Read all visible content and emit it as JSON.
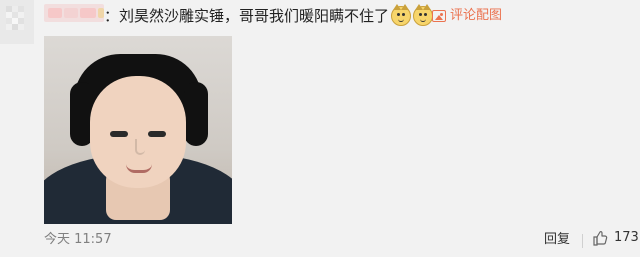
{
  "comment": {
    "text": "：刘昊然沙雕实锤，哥哥我们暖阳瞒不住了",
    "emojis": [
      "cat-face-emoji",
      "cat-face-emoji"
    ]
  },
  "actions": {
    "view_picture_label": "评论配图",
    "reply_label": "回复",
    "like_count": "173"
  },
  "meta": {
    "time": "今天 11:57"
  },
  "colors": {
    "accent": "#eb7350",
    "background": "#f2f2f2"
  },
  "icons": {
    "view_picture": "picture-icon",
    "like": "thumbs-up-icon"
  }
}
